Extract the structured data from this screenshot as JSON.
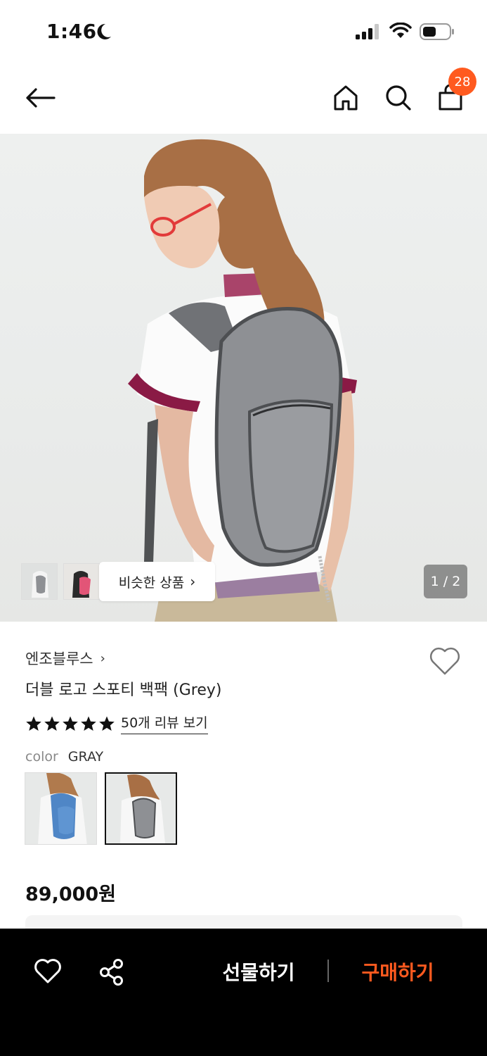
{
  "status_bar": {
    "time": "1:46",
    "icons": [
      "moon-icon",
      "signal-icon",
      "wifi-icon",
      "battery-icon"
    ]
  },
  "nav": {
    "icons": [
      "back-arrow-icon",
      "home-icon",
      "search-icon",
      "shopping-bag-icon"
    ],
    "cart_count": "28"
  },
  "gallery": {
    "similar_button_label": "비슷한 상품",
    "image_counter": "1 / 2",
    "current_image": 1,
    "total_images": 2
  },
  "product": {
    "brand": "엔조블루스",
    "title": "더블 로고 스포티 백팩 (Grey)",
    "rating_stars": 5,
    "review_link": "50개 리뷰 보기",
    "color_label": "color",
    "color_value": "GRAY",
    "swatches": [
      {
        "color": "blue",
        "selected": false
      },
      {
        "color": "gray",
        "selected": true
      }
    ],
    "price": "89,000원"
  },
  "bottom_bar": {
    "gift_label": "선물하기",
    "buy_label": "구매하기",
    "icons": [
      "heart-icon",
      "share-icon"
    ]
  },
  "colors": {
    "accent": "#ff5a1f",
    "bottom_bar_bg": "#000000",
    "badge": "#ff5a1f"
  }
}
